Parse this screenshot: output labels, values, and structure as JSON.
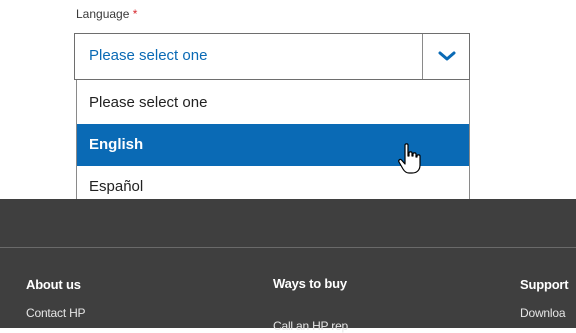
{
  "form": {
    "language_label": "Language",
    "required_mark": "*",
    "selected_value": "Please select one",
    "options": [
      "Please select one",
      "English",
      "Español"
    ],
    "highlighted_option": "English"
  },
  "footer": {
    "columns": [
      {
        "heading": "About us",
        "links": [
          "Contact HP"
        ]
      },
      {
        "heading": "Ways to buy",
        "links": [
          "Call an HP rep"
        ]
      },
      {
        "heading": "Support",
        "links": [
          "Downloa"
        ]
      }
    ]
  },
  "colors": {
    "accent": "#0a6ab5",
    "required": "#d7282f",
    "footer_bg": "#3f3f3f"
  }
}
